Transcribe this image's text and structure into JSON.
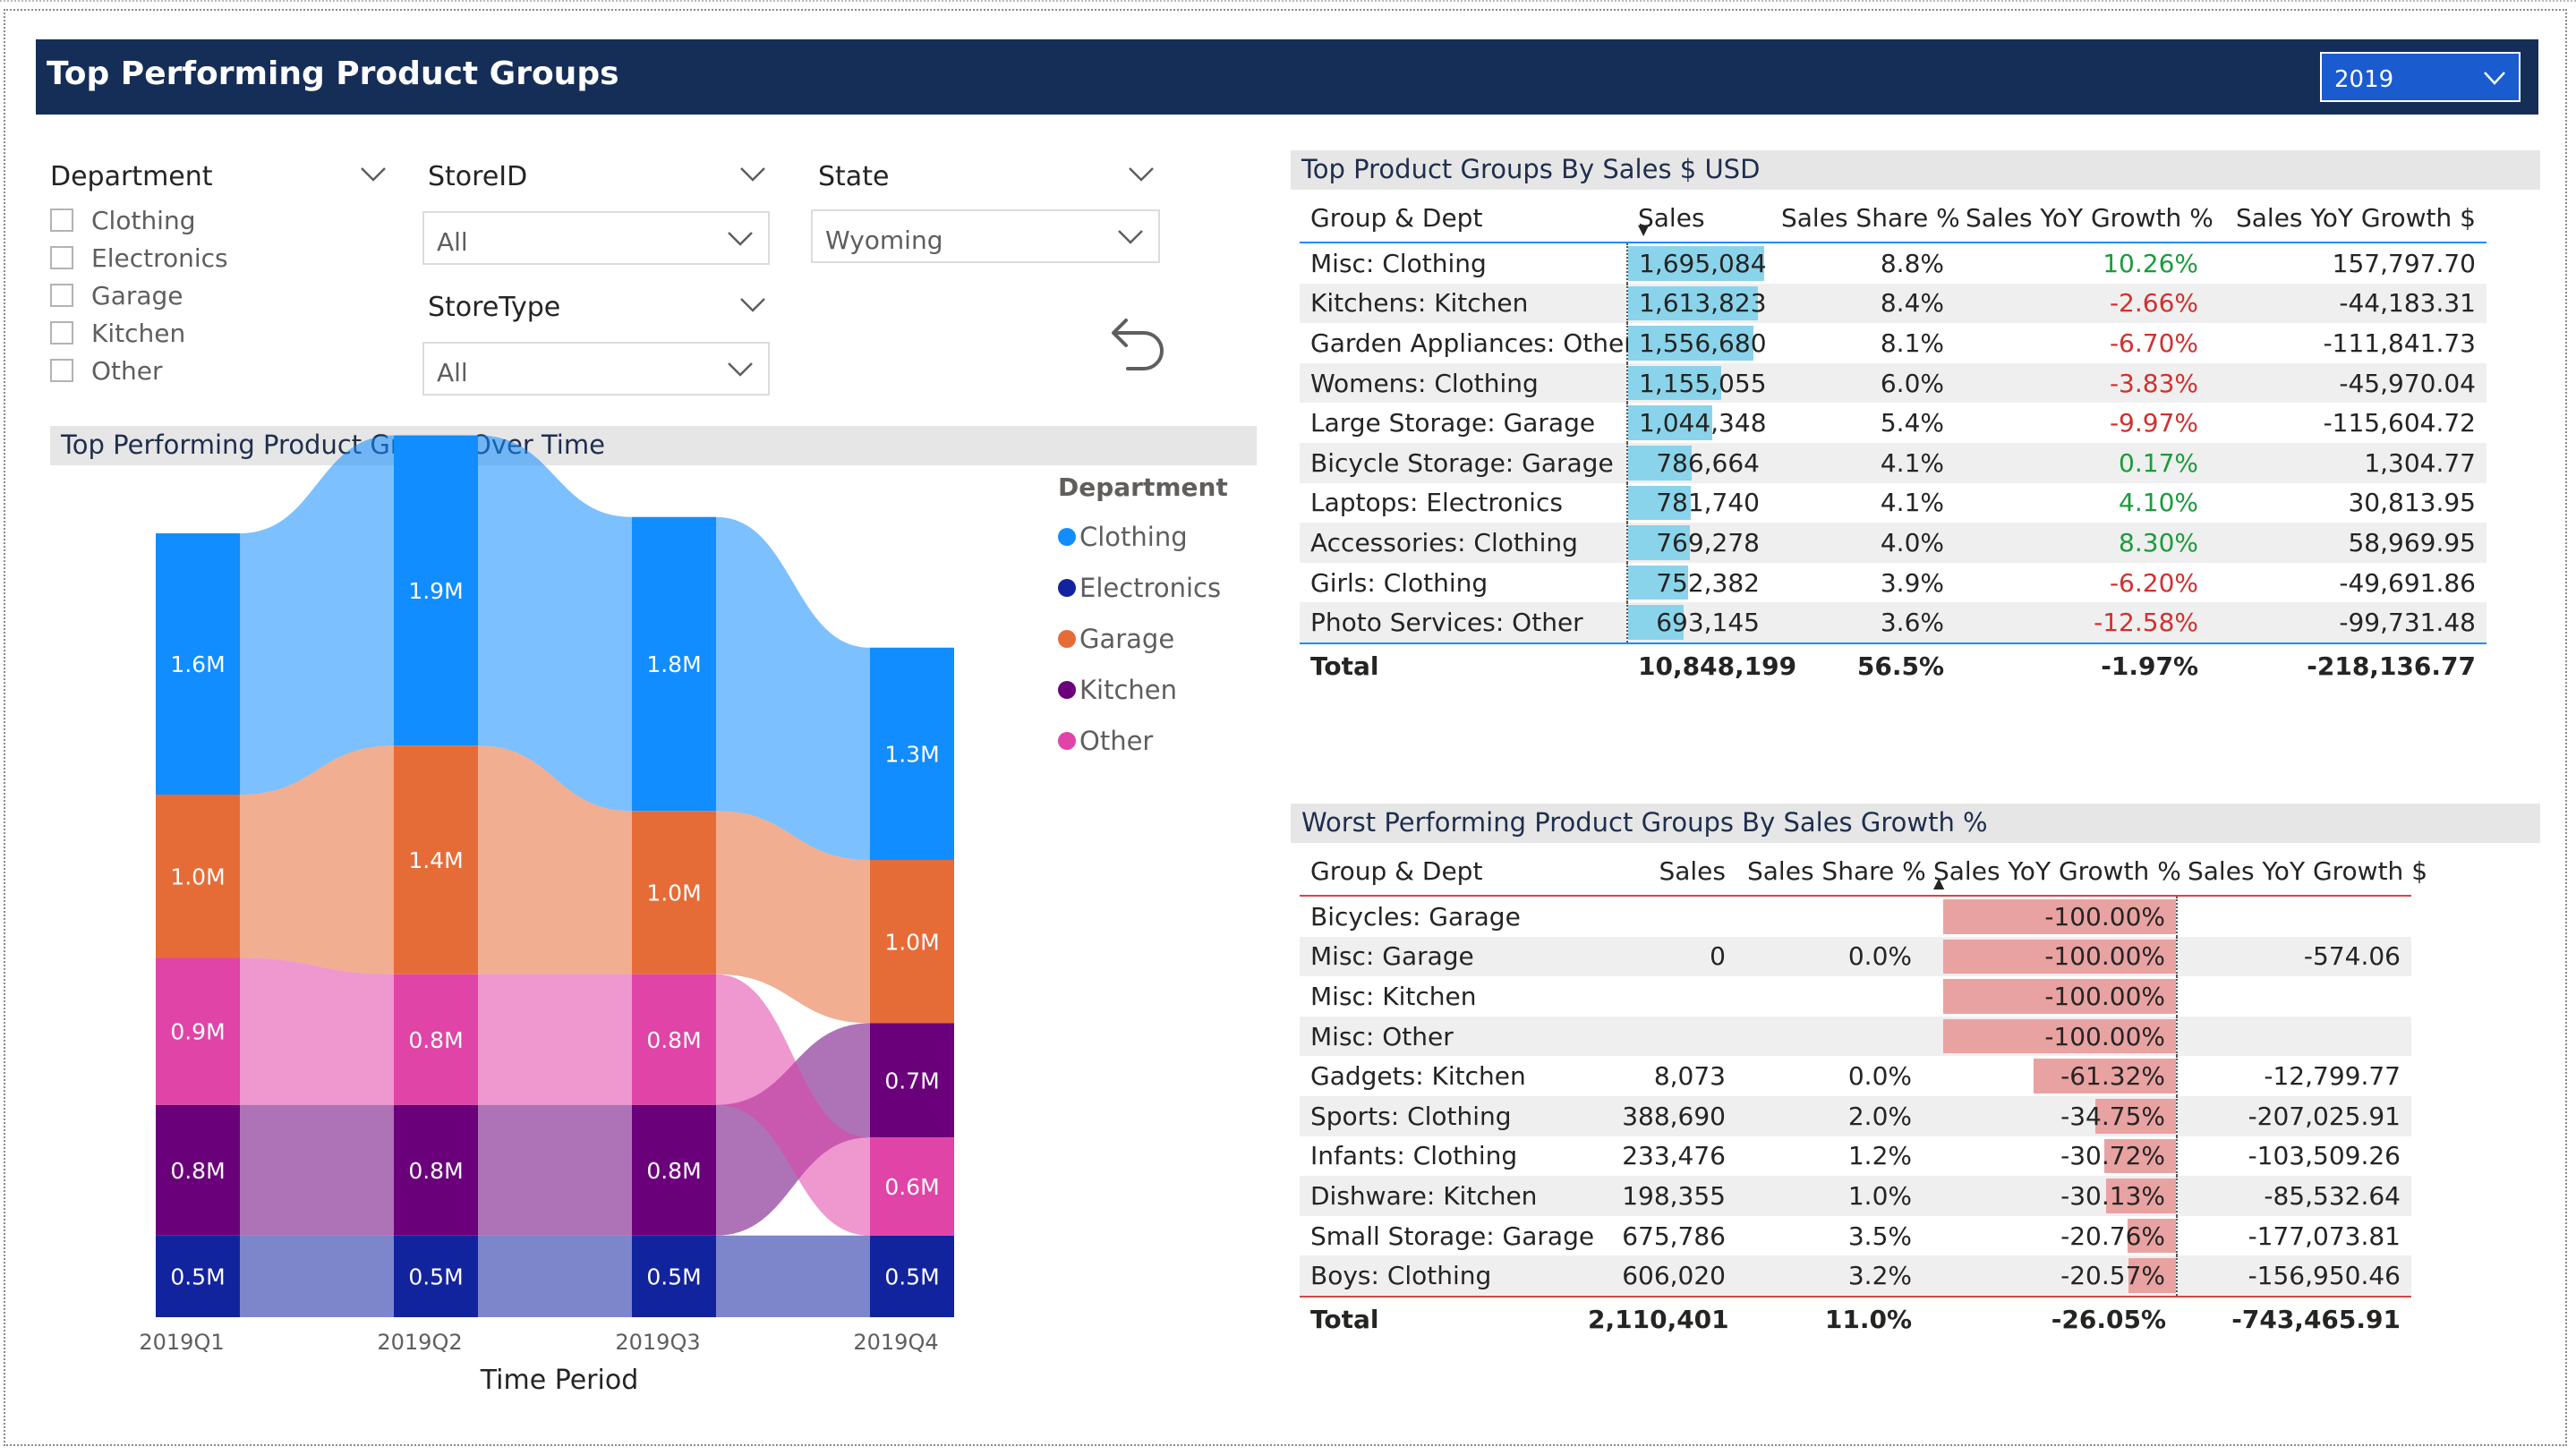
{
  "header": {
    "title": "Top Performing Product Groups",
    "year_dropdown": "2019"
  },
  "slicers": {
    "department": {
      "title": "Department",
      "options": [
        "Clothing",
        "Electronics",
        "Garage",
        "Kitchen",
        "Other"
      ]
    },
    "store_id": {
      "title": "StoreID",
      "value": "All"
    },
    "store_type": {
      "title": "StoreType",
      "value": "All"
    },
    "state": {
      "title": "State",
      "value": "Wyoming"
    }
  },
  "colors": {
    "Clothing": "#118dff",
    "Electronics": "#12239e",
    "Garage": "#e66c37",
    "Kitchen": "#6b007b",
    "Other": "#e044a7",
    "header_bg": "#152e57",
    "databar_top": "#8ad4eb",
    "databar_worst": "#e9a2a2"
  },
  "chart_data": {
    "type": "ribbon",
    "title": "Top Performing Product Groups Over Time",
    "xlabel": "Time Period",
    "categories": [
      "2019Q1",
      "2019Q2",
      "2019Q3",
      "2019Q4"
    ],
    "legend_title": "Department",
    "series": [
      {
        "name": "Clothing",
        "values": [
          1.6,
          1.9,
          1.8,
          1.3
        ],
        "labels": [
          "1.6M",
          "1.9M",
          "1.8M",
          "1.3M"
        ]
      },
      {
        "name": "Electronics",
        "values": [
          0.5,
          0.5,
          0.5,
          0.5
        ],
        "labels": [
          "0.5M",
          "0.5M",
          "0.5M",
          "0.5M"
        ]
      },
      {
        "name": "Garage",
        "values": [
          1.0,
          1.4,
          1.0,
          1.0
        ],
        "labels": [
          "1.0M",
          "1.4M",
          "1.0M",
          "1.0M"
        ]
      },
      {
        "name": "Kitchen",
        "values": [
          0.8,
          0.8,
          0.8,
          0.7
        ],
        "labels": [
          "0.8M",
          "0.8M",
          "0.8M",
          "0.7M"
        ]
      },
      {
        "name": "Other",
        "values": [
          0.9,
          0.8,
          0.8,
          0.6
        ],
        "labels": [
          "0.9M",
          "0.8M",
          "0.8M",
          "0.6M"
        ]
      }
    ],
    "stack_order_top_to_bottom": [
      [
        "Clothing",
        "Garage",
        "Other",
        "Kitchen",
        "Electronics"
      ],
      [
        "Clothing",
        "Garage",
        "Other",
        "Kitchen",
        "Electronics"
      ],
      [
        "Clothing",
        "Garage",
        "Other",
        "Kitchen",
        "Electronics"
      ],
      [
        "Clothing",
        "Garage",
        "Kitchen",
        "Other",
        "Electronics"
      ]
    ]
  },
  "top_table": {
    "title": "Top Product Groups By Sales $ USD",
    "columns": [
      "Group & Dept",
      "Sales",
      "Sales Share %",
      "Sales YoY Growth %",
      "Sales YoY Growth $"
    ],
    "rows": [
      {
        "group": "Misc: Clothing",
        "sales": "1,695,084",
        "sales_value": 1695084,
        "share": "8.8%",
        "growth_pct": "10.26%",
        "growth_usd": "157,797.70"
      },
      {
        "group": "Kitchens: Kitchen",
        "sales": "1,613,823",
        "sales_value": 1613823,
        "share": "8.4%",
        "growth_pct": "-2.66%",
        "growth_usd": "-44,183.31"
      },
      {
        "group": "Garden Appliances: Other",
        "sales": "1,556,680",
        "sales_value": 1556680,
        "share": "8.1%",
        "growth_pct": "-6.70%",
        "growth_usd": "-111,841.73"
      },
      {
        "group": "Womens: Clothing",
        "sales": "1,155,055",
        "sales_value": 1155055,
        "share": "6.0%",
        "growth_pct": "-3.83%",
        "growth_usd": "-45,970.04"
      },
      {
        "group": "Large Storage: Garage",
        "sales": "1,044,348",
        "sales_value": 1044348,
        "share": "5.4%",
        "growth_pct": "-9.97%",
        "growth_usd": "-115,604.72"
      },
      {
        "group": "Bicycle Storage: Garage",
        "sales": "786,664",
        "sales_value": 786664,
        "share": "4.1%",
        "growth_pct": "0.17%",
        "growth_usd": "1,304.77"
      },
      {
        "group": "Laptops: Electronics",
        "sales": "781,740",
        "sales_value": 781740,
        "share": "4.1%",
        "growth_pct": "4.10%",
        "growth_usd": "30,813.95"
      },
      {
        "group": "Accessories: Clothing",
        "sales": "769,278",
        "sales_value": 769278,
        "share": "4.0%",
        "growth_pct": "8.30%",
        "growth_usd": "58,969.95"
      },
      {
        "group": "Girls: Clothing",
        "sales": "752,382",
        "sales_value": 752382,
        "share": "3.9%",
        "growth_pct": "-6.20%",
        "growth_usd": "-49,691.86"
      },
      {
        "group": "Photo Services: Other",
        "sales": "693,145",
        "sales_value": 693145,
        "share": "3.6%",
        "growth_pct": "-12.58%",
        "growth_usd": "-99,731.48"
      }
    ],
    "total": {
      "label": "Total",
      "sales": "10,848,199",
      "share": "56.5%",
      "growth_pct": "-1.97%",
      "growth_usd": "-218,136.77"
    }
  },
  "worst_table": {
    "title": "Worst Performing Product Groups By Sales Growth %",
    "columns": [
      "Group & Dept",
      "Sales",
      "Sales Share %",
      "Sales YoY Growth %",
      "Sales YoY Growth $"
    ],
    "rows": [
      {
        "group": "Bicycles: Garage",
        "sales": "",
        "share": "",
        "growth_pct": "-100.00%",
        "growth_value": -100.0,
        "growth_usd": ""
      },
      {
        "group": "Misc: Garage",
        "sales": "0",
        "share": "0.0%",
        "growth_pct": "-100.00%",
        "growth_value": -100.0,
        "growth_usd": "-574.06"
      },
      {
        "group": "Misc: Kitchen",
        "sales": "",
        "share": "",
        "growth_pct": "-100.00%",
        "growth_value": -100.0,
        "growth_usd": ""
      },
      {
        "group": "Misc: Other",
        "sales": "",
        "share": "",
        "growth_pct": "-100.00%",
        "growth_value": -100.0,
        "growth_usd": ""
      },
      {
        "group": "Gadgets: Kitchen",
        "sales": "8,073",
        "share": "0.0%",
        "growth_pct": "-61.32%",
        "growth_value": -61.32,
        "growth_usd": "-12,799.77"
      },
      {
        "group": "Sports: Clothing",
        "sales": "388,690",
        "share": "2.0%",
        "growth_pct": "-34.75%",
        "growth_value": -34.75,
        "growth_usd": "-207,025.91"
      },
      {
        "group": "Infants: Clothing",
        "sales": "233,476",
        "share": "1.2%",
        "growth_pct": "-30.72%",
        "growth_value": -30.72,
        "growth_usd": "-103,509.26"
      },
      {
        "group": "Dishware: Kitchen",
        "sales": "198,355",
        "share": "1.0%",
        "growth_pct": "-30.13%",
        "growth_value": -30.13,
        "growth_usd": "-85,532.64"
      },
      {
        "group": "Small Storage: Garage",
        "sales": "675,786",
        "share": "3.5%",
        "growth_pct": "-20.76%",
        "growth_value": -20.76,
        "growth_usd": "-177,073.81"
      },
      {
        "group": "Boys: Clothing",
        "sales": "606,020",
        "share": "3.2%",
        "growth_pct": "-20.57%",
        "growth_value": -20.57,
        "growth_usd": "-156,950.46"
      }
    ],
    "total": {
      "label": "Total",
      "sales": "2,110,401",
      "share": "11.0%",
      "growth_pct": "-26.05%",
      "growth_usd": "-743,465.91"
    }
  }
}
